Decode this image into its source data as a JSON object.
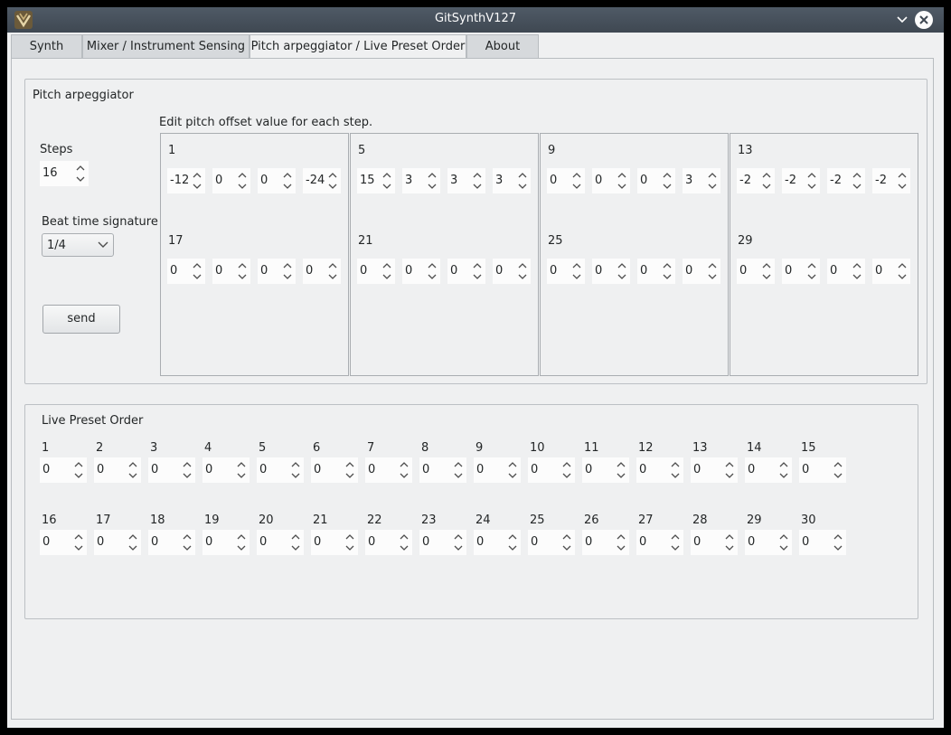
{
  "window": {
    "title": "GitSynthV127"
  },
  "tabs": [
    {
      "label": "Synth"
    },
    {
      "label": "Mixer / Instrument Sensing"
    },
    {
      "label": "Pitch arpeggiator / Live Preset Order"
    },
    {
      "label": "About"
    }
  ],
  "active_tab": 2,
  "pitch": {
    "title": "Pitch arpeggiator",
    "instruction": "Edit pitch offset value for each step.",
    "steps_label": "Steps",
    "steps_value": "16",
    "beat_label": "Beat time signature",
    "beat_value": "1/4",
    "send_label": "send",
    "groups": [
      {
        "row1_label": "1",
        "row1": [
          "-12",
          "0",
          "0",
          "-24"
        ],
        "row2_label": "17",
        "row2": [
          "0",
          "0",
          "0",
          "0"
        ]
      },
      {
        "row1_label": "5",
        "row1": [
          "15",
          "3",
          "3",
          "3"
        ],
        "row2_label": "21",
        "row2": [
          "0",
          "0",
          "0",
          "0"
        ]
      },
      {
        "row1_label": "9",
        "row1": [
          "0",
          "0",
          "0",
          "3"
        ],
        "row2_label": "25",
        "row2": [
          "0",
          "0",
          "0",
          "0"
        ]
      },
      {
        "row1_label": "13",
        "row1": [
          "-2",
          "-2",
          "-2",
          "-2"
        ],
        "row2_label": "29",
        "row2": [
          "0",
          "0",
          "0",
          "0"
        ]
      }
    ]
  },
  "live_preset": {
    "title": "Live Preset Order",
    "row1_labels": [
      "1",
      "2",
      "3",
      "4",
      "5",
      "6",
      "7",
      "8",
      "9",
      "10",
      "11",
      "12",
      "13",
      "14",
      "15"
    ],
    "row1_values": [
      "0",
      "0",
      "0",
      "0",
      "0",
      "0",
      "0",
      "0",
      "0",
      "0",
      "0",
      "0",
      "0",
      "0",
      "0"
    ],
    "row2_labels": [
      "16",
      "17",
      "18",
      "19",
      "20",
      "21",
      "22",
      "23",
      "24",
      "25",
      "26",
      "27",
      "28",
      "29",
      "30"
    ],
    "row2_values": [
      "0",
      "0",
      "0",
      "0",
      "0",
      "0",
      "0",
      "0",
      "0",
      "0",
      "0",
      "0",
      "0",
      "0",
      "0"
    ]
  }
}
